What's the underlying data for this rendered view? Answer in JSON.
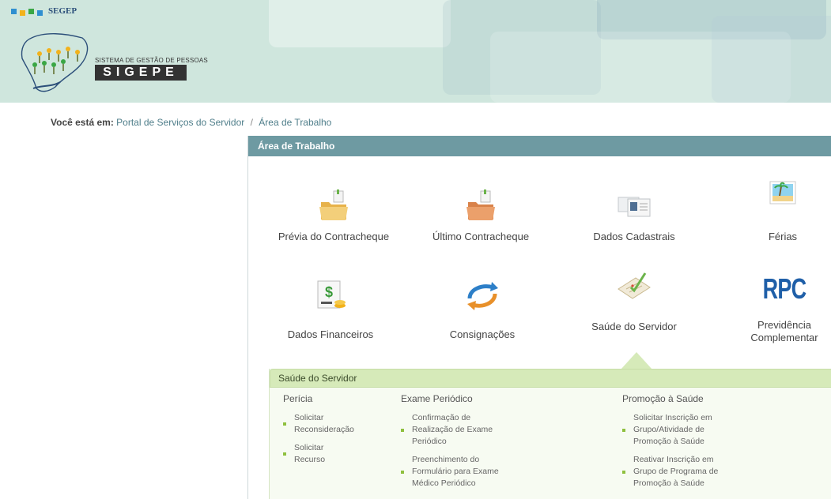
{
  "header": {
    "org_label": "SEGEP",
    "system_caption": "SISTEMA DE GESTÃO DE PESSOAS",
    "system_name": "SIGEPE"
  },
  "breadcrumb": {
    "prefix": "Você está em:",
    "items": [
      "Portal de Serviços do Servidor",
      "Área de Trabalho"
    ],
    "separator": "/"
  },
  "panel": {
    "title": "Área de Trabalho",
    "tiles": [
      {
        "label": "Prévia do Contracheque",
        "icon": "folder-icon"
      },
      {
        "label": "Último Contracheque",
        "icon": "folder-icon"
      },
      {
        "label": "Dados Cadastrais",
        "icon": "id-card-icon"
      },
      {
        "label": "Férias",
        "icon": "beach-picture-icon"
      },
      {
        "label": "Dados Financeiros",
        "icon": "dollar-document-icon"
      },
      {
        "label": "Consignações",
        "icon": "refresh-arrows-icon"
      },
      {
        "label": "Saúde do Servidor",
        "icon": "clipboard-check-icon"
      },
      {
        "label": "Previdência",
        "label2": "Complementar",
        "icon_text": "RPC",
        "icon": "rpc-icon"
      }
    ]
  },
  "submenu": {
    "title": "Saúde do Servidor",
    "columns": [
      {
        "title": "Perícia",
        "items": [
          [
            "Solicitar",
            "Reconsideração"
          ],
          [
            "Solicitar",
            "Recurso"
          ]
        ]
      },
      {
        "title": "Exame Periódico",
        "items": [
          [
            "Confirmação de",
            "Realização de Exame",
            "Periódico"
          ],
          [
            "Preenchimento do",
            "Formulário para Exame",
            "Médico Periódico"
          ]
        ]
      },
      {
        "title": "Promoção à Saúde",
        "items": [
          [
            "Solicitar Inscrição em",
            "Grupo/Atividade de",
            "Promoção à Saúde"
          ],
          [
            "Reativar Inscrição em",
            "Grupo de Programa de",
            "Promoção à Saúde"
          ]
        ]
      }
    ]
  },
  "colors": {
    "header_bg": "#cfe6dd",
    "panel_head": "#6e9aa2",
    "sub_head": "#d6eab9",
    "bullet": "#8fc03f",
    "rpc": "#1f5fa8"
  }
}
